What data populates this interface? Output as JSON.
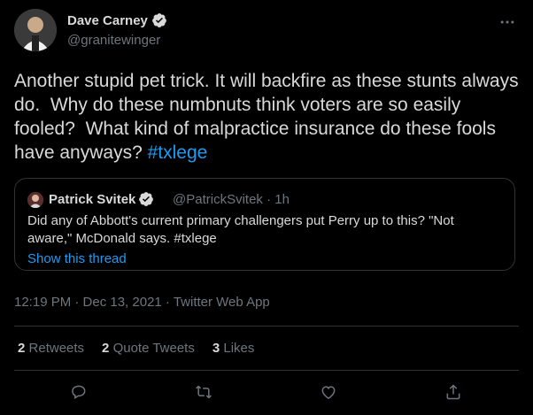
{
  "author": {
    "display_name": "Dave Carney",
    "handle": "@granitewinger",
    "avatar_icon": "user-avatar",
    "verified_icon": "verified-badge-icon"
  },
  "tweet": {
    "text": "Another stupid pet trick. It will backfire as these stunts always do.  Why do these numbnuts think voters are so easily fooled?  What kind of malpractice insurance do these fools have anyways? ",
    "hashtag": "#txlege",
    "timestamp": "12:19 PM · Dec 13, 2021 · Twitter Web App"
  },
  "quote": {
    "display_name": "Patrick Svitek",
    "meta": "@PatrickSvitek · 1h",
    "text": "Did any of Abbott's current primary challengers put Perry up to this? \"Not aware,\" McDonald says. #txlege",
    "show_thread": "Show this thread"
  },
  "stats": {
    "retweets_count": "2",
    "retweets_label": "Retweets",
    "quotes_count": "2",
    "quotes_label": "Quote Tweets",
    "likes_count": "3",
    "likes_label": "Likes"
  },
  "colors": {
    "background": "#000000",
    "text": "#d9d9d9",
    "secondary": "#6e767d",
    "accent": "#1d9bf0",
    "border": "#2f3336"
  }
}
